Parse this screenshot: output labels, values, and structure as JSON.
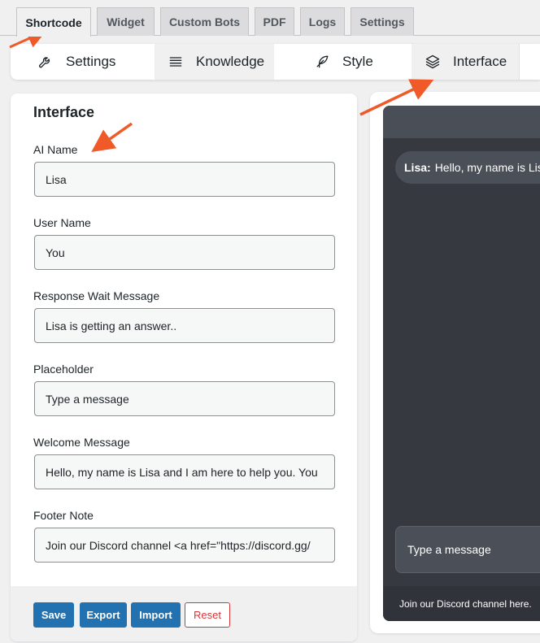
{
  "top_tabs": [
    {
      "label": "Shortcode",
      "active": true
    },
    {
      "label": "Widget"
    },
    {
      "label": "Custom Bots"
    },
    {
      "label": "PDF"
    },
    {
      "label": "Logs"
    },
    {
      "label": "Settings"
    }
  ],
  "sub_tabs": [
    {
      "label": "Settings",
      "icon": "wrench-icon"
    },
    {
      "label": "Knowledge",
      "icon": "list-icon"
    },
    {
      "label": "Style",
      "icon": "feather-icon"
    },
    {
      "label": "Interface",
      "icon": "layers-icon",
      "active": true
    }
  ],
  "panel": {
    "title": "Interface",
    "fields": [
      {
        "label": "AI Name",
        "value": "Lisa"
      },
      {
        "label": "User Name",
        "value": "You"
      },
      {
        "label": "Response Wait Message",
        "value": "Lisa is getting an answer.."
      },
      {
        "label": "Placeholder",
        "value": "Type a message"
      },
      {
        "label": "Welcome Message",
        "value": "Hello, my name is Lisa and I am here to help you. You"
      },
      {
        "label": "Footer Note",
        "value": "Join our Discord channel <a href=\"https://discord.gg/"
      }
    ],
    "buttons": {
      "save": "Save",
      "export": "Export",
      "import": "Import",
      "reset": "Reset"
    }
  },
  "preview": {
    "ai_name": "Lisa:",
    "welcome_text": "Hello, my name is Lis",
    "input_placeholder": "Type a message",
    "footer_text": "Join our Discord channel here."
  },
  "colors": {
    "accent": "#2271b1",
    "reset": "#d63638",
    "annotation_arrow": "#f05a28",
    "chat_background": "#363940"
  }
}
